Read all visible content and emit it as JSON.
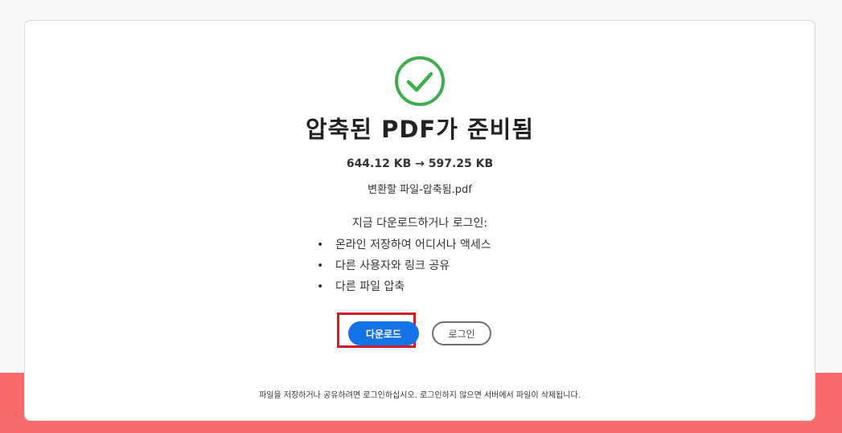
{
  "result": {
    "title": "압축된 PDF가 준비됨",
    "sizes": "644.12 KB → 597.25 KB",
    "filename": "변환할 파일-압축됨.pdf"
  },
  "prompt": {
    "intro": "지금 다운로드하거나 로그인:",
    "benefits": [
      "온라인 저장하여 어디서나 액세스",
      "다른 사용자와 링크 공유",
      "다른 파일 압축"
    ]
  },
  "actions": {
    "download_label": "다운로드",
    "login_label": "로그인"
  },
  "footer": {
    "note": "파일을 저장하거나 공유하려면 로그인하십시오. 로그인하지 않으면 서버에서 파일이 삭제됩니다."
  },
  "icons": {
    "success": "check-circle-icon",
    "bullet": "•"
  },
  "colors": {
    "success_green": "#3fac4d",
    "primary_blue": "#1473e6",
    "highlight_red": "#d11c24",
    "background_band": "#fa6a6a"
  }
}
